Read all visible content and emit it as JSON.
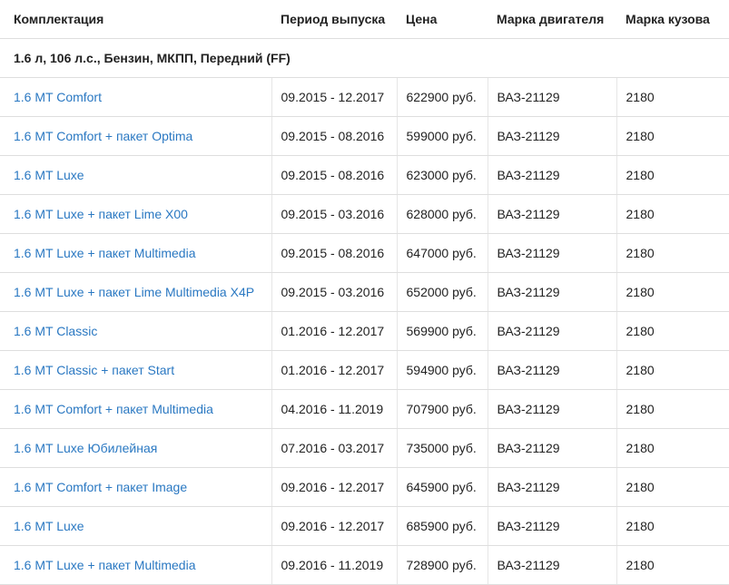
{
  "headers": [
    "Комплектация",
    "Период выпуска",
    "Цена",
    "Марка двигателя",
    "Марка кузова"
  ],
  "group": "1.6 л, 106 л.с., Бензин, МКПП, Передний (FF)",
  "rows": [
    {
      "trim": "1.6 MT Comfort",
      "period": "09.2015 - 12.2017",
      "price": "622900 руб.",
      "engine": "ВАЗ-21129",
      "body": "2180"
    },
    {
      "trim": "1.6 MT Comfort + пакет Optima",
      "period": "09.2015 - 08.2016",
      "price": "599000 руб.",
      "engine": "ВАЗ-21129",
      "body": "2180"
    },
    {
      "trim": "1.6 MT Luxe",
      "period": "09.2015 - 08.2016",
      "price": "623000 руб.",
      "engine": "ВАЗ-21129",
      "body": "2180"
    },
    {
      "trim": "1.6 MT Luxe + пакет Lime X00",
      "period": "09.2015 - 03.2016",
      "price": "628000 руб.",
      "engine": "ВАЗ-21129",
      "body": "2180"
    },
    {
      "trim": "1.6 MT Luxe + пакет Multimedia",
      "period": "09.2015 - 08.2016",
      "price": "647000 руб.",
      "engine": "ВАЗ-21129",
      "body": "2180"
    },
    {
      "trim": "1.6 MT Luxe + пакет Lime Multimedia X4P",
      "period": "09.2015 - 03.2016",
      "price": "652000 руб.",
      "engine": "ВАЗ-21129",
      "body": "2180"
    },
    {
      "trim": "1.6 MT Classic",
      "period": "01.2016 - 12.2017",
      "price": "569900 руб.",
      "engine": "ВАЗ-21129",
      "body": "2180"
    },
    {
      "trim": "1.6 MT Classic + пакет Start",
      "period": "01.2016 - 12.2017",
      "price": "594900 руб.",
      "engine": "ВАЗ-21129",
      "body": "2180"
    },
    {
      "trim": "1.6 MT Comfort + пакет Multimedia",
      "period": "04.2016 - 11.2019",
      "price": "707900 руб.",
      "engine": "ВАЗ-21129",
      "body": "2180"
    },
    {
      "trim": "1.6 MT Luxe Юбилейная",
      "period": "07.2016 - 03.2017",
      "price": "735000 руб.",
      "engine": "ВАЗ-21129",
      "body": "2180"
    },
    {
      "trim": "1.6 MT Comfort + пакет Image",
      "period": "09.2016 - 12.2017",
      "price": "645900 руб.",
      "engine": "ВАЗ-21129",
      "body": "2180"
    },
    {
      "trim": "1.6 MT Luxe",
      "period": "09.2016 - 12.2017",
      "price": "685900 руб.",
      "engine": "ВАЗ-21129",
      "body": "2180"
    },
    {
      "trim": "1.6 MT Luxe + пакет Multimedia",
      "period": "09.2016 - 11.2019",
      "price": "728900 руб.",
      "engine": "ВАЗ-21129",
      "body": "2180"
    }
  ],
  "colors": {
    "link": "#2a78c2",
    "border": "#dedede",
    "text": "#222222"
  }
}
